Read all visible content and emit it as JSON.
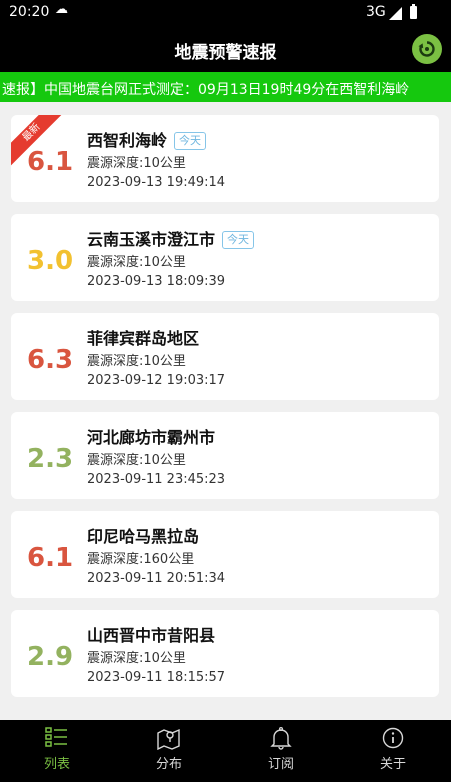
{
  "status_bar": {
    "time": "20:20",
    "network": "3G"
  },
  "header": {
    "title": "地震预警速报"
  },
  "ticker": {
    "text": "速报】中国地震台网正式测定：09月13日19时49分在西智利海岭"
  },
  "badge_new": "最新",
  "today_label": "今天",
  "earthquakes": [
    {
      "magnitude": "6.1",
      "place": "西智利海岭",
      "depth": "震源深度:10公里",
      "time": "2023-09-13 19:49:14",
      "color": "#d9553f",
      "is_today": true,
      "is_latest": true
    },
    {
      "magnitude": "3.0",
      "place": "云南玉溪市澄江市",
      "depth": "震源深度:10公里",
      "time": "2023-09-13 18:09:39",
      "color": "#f2c130",
      "is_today": true,
      "is_latest": false
    },
    {
      "magnitude": "6.3",
      "place": "菲律宾群岛地区",
      "depth": "震源深度:10公里",
      "time": "2023-09-12 19:03:17",
      "color": "#d9553f",
      "is_today": false,
      "is_latest": false
    },
    {
      "magnitude": "2.3",
      "place": "河北廊坊市霸州市",
      "depth": "震源深度:10公里",
      "time": "2023-09-11 23:45:23",
      "color": "#93b25f",
      "is_today": false,
      "is_latest": false
    },
    {
      "magnitude": "6.1",
      "place": "印尼哈马黑拉岛",
      "depth": "震源深度:160公里",
      "time": "2023-09-11 20:51:34",
      "color": "#d9553f",
      "is_today": false,
      "is_latest": false
    },
    {
      "magnitude": "2.9",
      "place": "山西晋中市昔阳县",
      "depth": "震源深度:10公里",
      "time": "2023-09-11 18:15:57",
      "color": "#93b25f",
      "is_today": false,
      "is_latest": false
    }
  ],
  "nav": [
    {
      "label": "列表",
      "icon": "list-icon",
      "active": true
    },
    {
      "label": "分布",
      "icon": "map-icon",
      "active": false
    },
    {
      "label": "订阅",
      "icon": "bell-icon",
      "active": false
    },
    {
      "label": "关于",
      "icon": "info-icon",
      "active": false
    }
  ],
  "colors": {
    "accent_green": "#15c80e",
    "active_nav": "#7bc043",
    "inactive_nav": "#d8d8d8"
  }
}
